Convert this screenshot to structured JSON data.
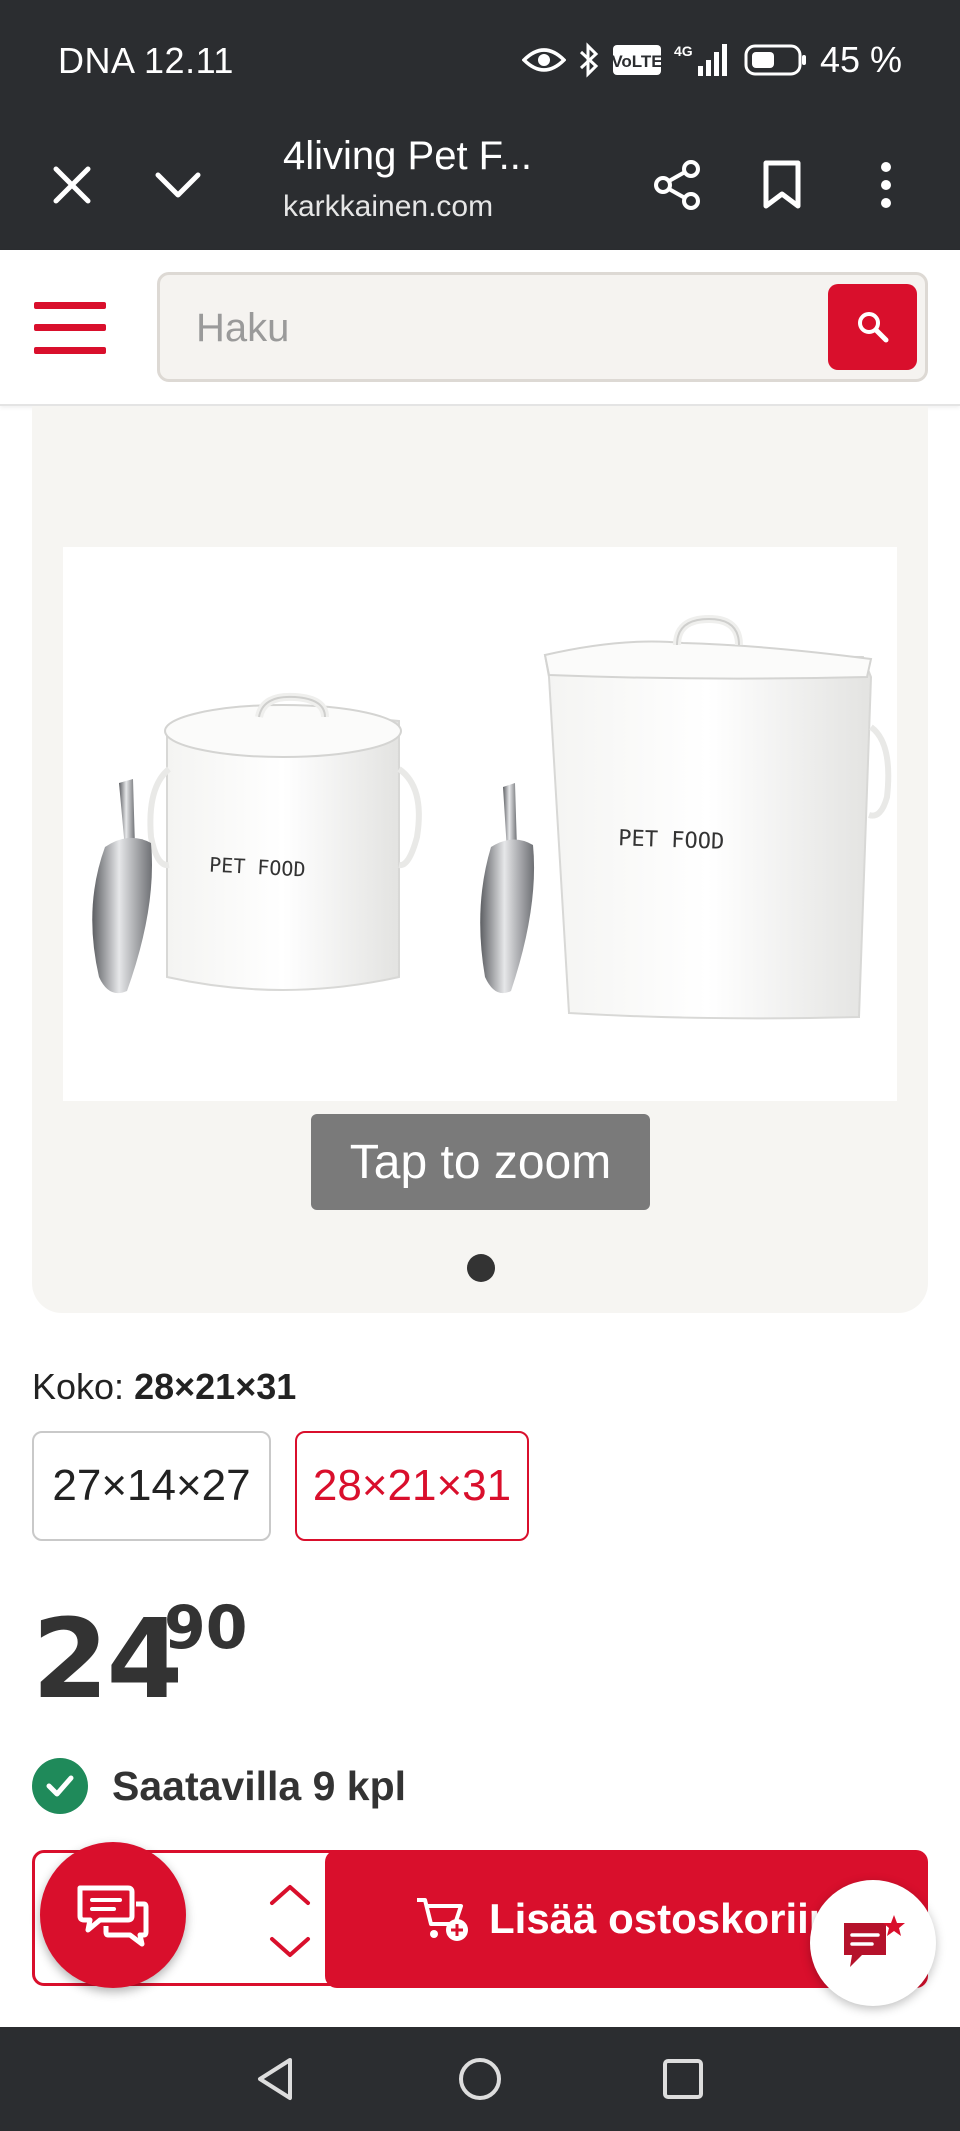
{
  "status_bar": {
    "carrier_time": "DNA 12.11",
    "network": "4G",
    "battery": "45 %"
  },
  "browser": {
    "tab_title": "4living Pet F...",
    "url": "karkkainen.com"
  },
  "header": {
    "search_placeholder": "Haku"
  },
  "gallery": {
    "image_texts": [
      "PET FOOD",
      "PET FOOD"
    ],
    "zoom_hint": "Tap to zoom",
    "slide_count": 1,
    "current_slide": 1
  },
  "size": {
    "label": "Koko:",
    "selected": "28×21×31",
    "options": [
      "27×14×27",
      "28×21×31"
    ]
  },
  "price": {
    "whole": "24",
    "cents": "90"
  },
  "availability": {
    "text": "Saatavilla 9 kpl"
  },
  "cart": {
    "button_label": "Lisää ostoskoriin"
  },
  "colors": {
    "brand_red": "#d90f2c",
    "available_green": "#1f8a5a",
    "system_bar": "#2b2d30"
  },
  "icons": [
    "eye-icon",
    "bluetooth-icon",
    "volte-icon",
    "signal-icon",
    "battery-icon",
    "close-icon",
    "chevron-down-icon",
    "share-icon",
    "bookmark-icon",
    "more-vert-icon",
    "menu-icon",
    "search-icon",
    "check-icon",
    "chevron-up-icon",
    "cart-add-icon",
    "chat-icon",
    "feedback-icon",
    "nav-back-icon",
    "nav-home-icon",
    "nav-recents-icon"
  ]
}
